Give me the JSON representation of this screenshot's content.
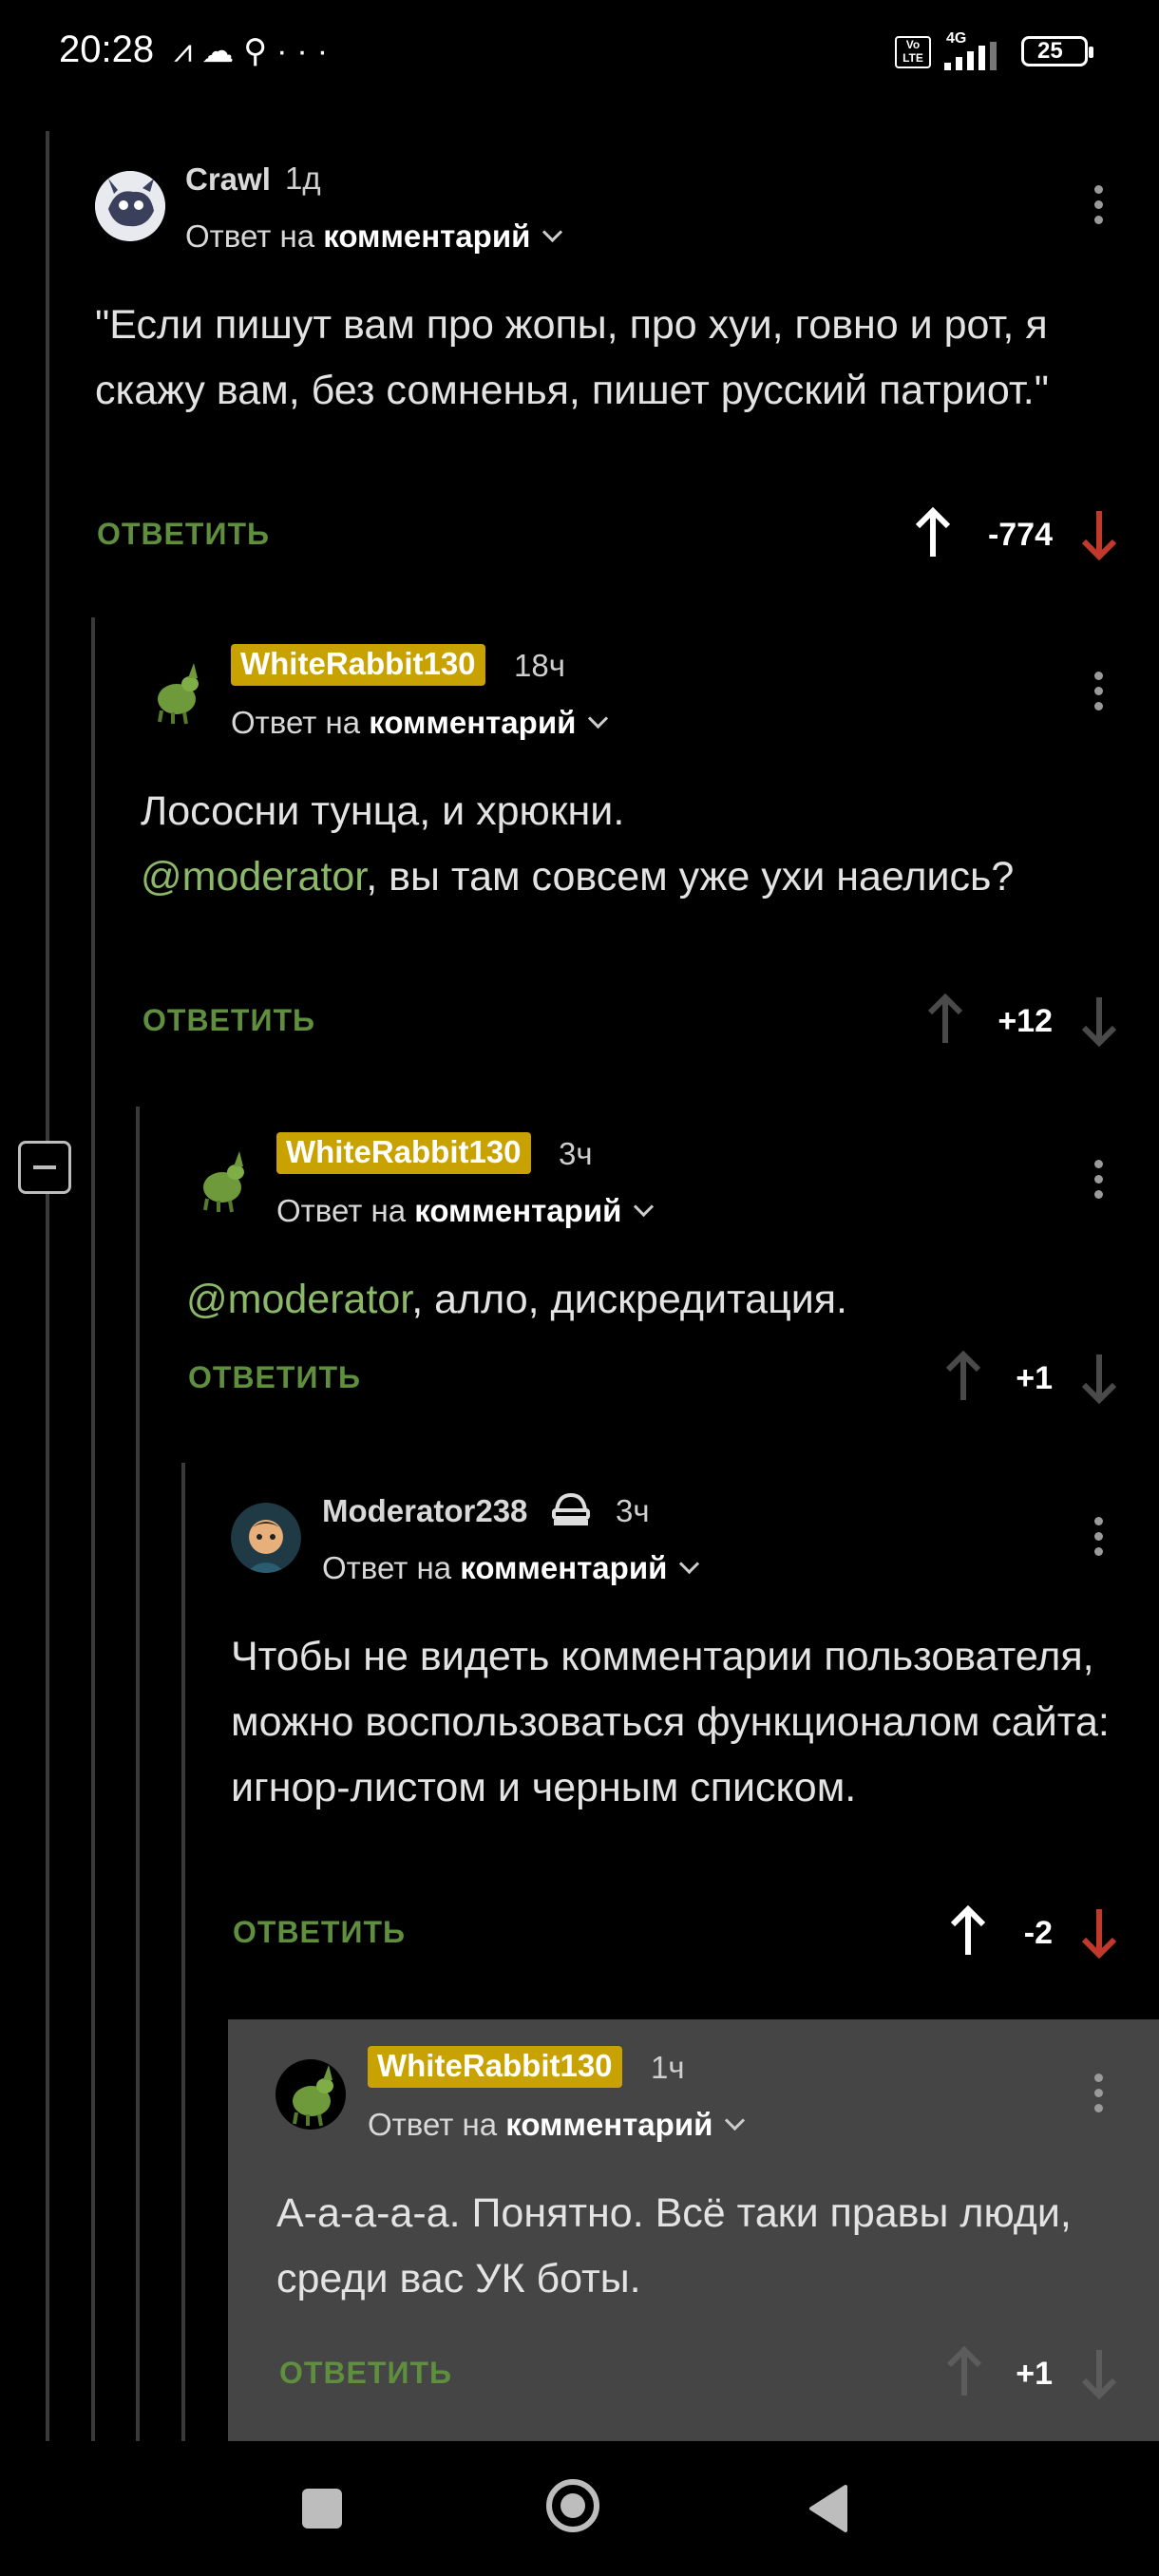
{
  "status_bar": {
    "time": "20:28",
    "notification_icons": [
      "app-icon",
      "cloud-icon",
      "bird-icon",
      "more-icon"
    ],
    "network": "4G",
    "volte": "Vo LTE",
    "battery": "25"
  },
  "comments": [
    {
      "username": "Crawl",
      "highlighted": false,
      "time": "1д",
      "reply_prefix": "Ответ на ",
      "reply_target": "комментарий",
      "text_parts": [
        {
          "text": "\"Если пишут вам про жопы, про хуи, говно и рот, я скажу вам, без сомненья, пишет русский патриот.\"",
          "mention": false
        }
      ],
      "reply_label": "ОТВЕТИТЬ",
      "score": "-774",
      "vote": "down"
    },
    {
      "username": "WhiteRabbit130",
      "highlighted": true,
      "time": "18ч",
      "reply_prefix": "Ответ на ",
      "reply_target": "комментарий",
      "text_parts": [
        {
          "text": "Лососни тунца, и хрюкни.",
          "mention": false,
          "break": true
        },
        {
          "text": "@moderator",
          "mention": true
        },
        {
          "text": ", вы там совсем уже ухи наелись?",
          "mention": false
        }
      ],
      "reply_label": "ОТВЕТИТЬ",
      "score": "+12",
      "vote": "none"
    },
    {
      "username": "WhiteRabbit130",
      "highlighted": true,
      "time": "3ч",
      "reply_prefix": "Ответ на ",
      "reply_target": "комментарий",
      "text_parts": [
        {
          "text": "@moderator",
          "mention": true
        },
        {
          "text": ", алло, дискредитация.",
          "mention": false
        }
      ],
      "reply_label": "ОТВЕТИТЬ",
      "score": "+1",
      "vote": "none"
    },
    {
      "username": "Moderator238",
      "highlighted": false,
      "badge_icon": "moderator-hat-icon",
      "time": "3ч",
      "reply_prefix": "Ответ на ",
      "reply_target": "комментарий",
      "text_parts": [
        {
          "text": "Чтобы не видеть комментарии пользователя, можно воспользоваться функционалом сайта: игнор-листом и черным списком.",
          "mention": false
        }
      ],
      "reply_label": "ОТВЕТИТЬ",
      "score": "-2",
      "vote": "down"
    },
    {
      "username": "WhiteRabbit130",
      "highlighted": true,
      "time": "1ч",
      "reply_prefix": "Ответ на ",
      "reply_target": "комментарий",
      "text_parts": [
        {
          "text": "А-а-а-а-а. Понятно. Всё таки правы люди, среди вас УК боты.",
          "mention": false
        }
      ],
      "reply_label": "ОТВЕТИТЬ",
      "score": "+1",
      "vote": "none",
      "selected": true
    }
  ],
  "colors": {
    "background": "#000000",
    "selected_comment": "#454545",
    "reply_green": "#5f8f3e",
    "mention_green": "#8cb86a",
    "username_highlight": "#c8a200",
    "downvote_red": "#c0392b"
  },
  "nav_bar": {
    "buttons": [
      "recents-square-icon",
      "home-circle-icon",
      "back-triangle-icon"
    ]
  }
}
